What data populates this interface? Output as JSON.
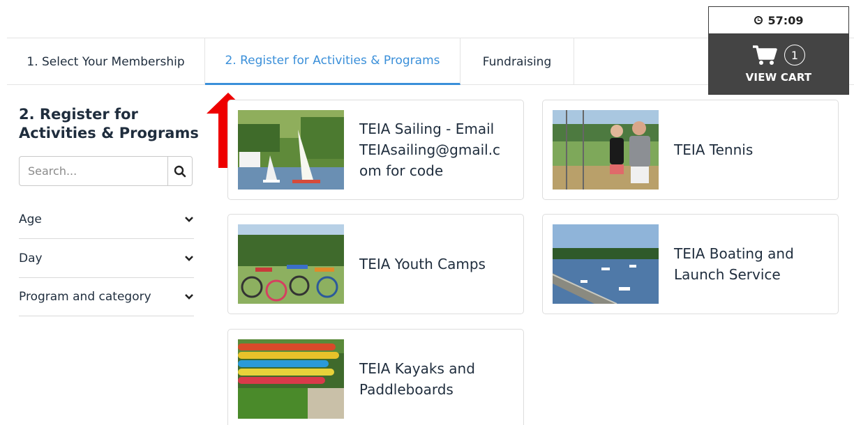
{
  "tabs": [
    {
      "label": "1. Select Your Membership",
      "active": false
    },
    {
      "label": "2. Register for Activities & Programs",
      "active": true
    },
    {
      "label": "Fundraising",
      "active": false
    }
  ],
  "cart": {
    "timer": "57:09",
    "count": "1",
    "view_label": "VIEW CART"
  },
  "sidebar": {
    "title_line1": "2. Register for",
    "title_line2": "Activities & Programs",
    "search_placeholder": "Search...",
    "filters": [
      {
        "label": "Age"
      },
      {
        "label": "Day"
      },
      {
        "label": "Program and category"
      }
    ]
  },
  "programs": [
    {
      "line1": "TEIA Sailing - Email",
      "line2": "TEIAsailing@gmail.c",
      "line3": "om for code"
    },
    {
      "line1": "TEIA Tennis"
    },
    {
      "line1": "TEIA Youth Camps"
    },
    {
      "line1": "TEIA Boating and",
      "line2": "Launch Service"
    },
    {
      "line1": "TEIA Kayaks and",
      "line2": "Paddleboards"
    }
  ],
  "colors": {
    "accent": "#3a8fd9",
    "text": "#1f2d3d",
    "cart_bg": "#444444",
    "annotation_arrow": "#ee0000"
  }
}
